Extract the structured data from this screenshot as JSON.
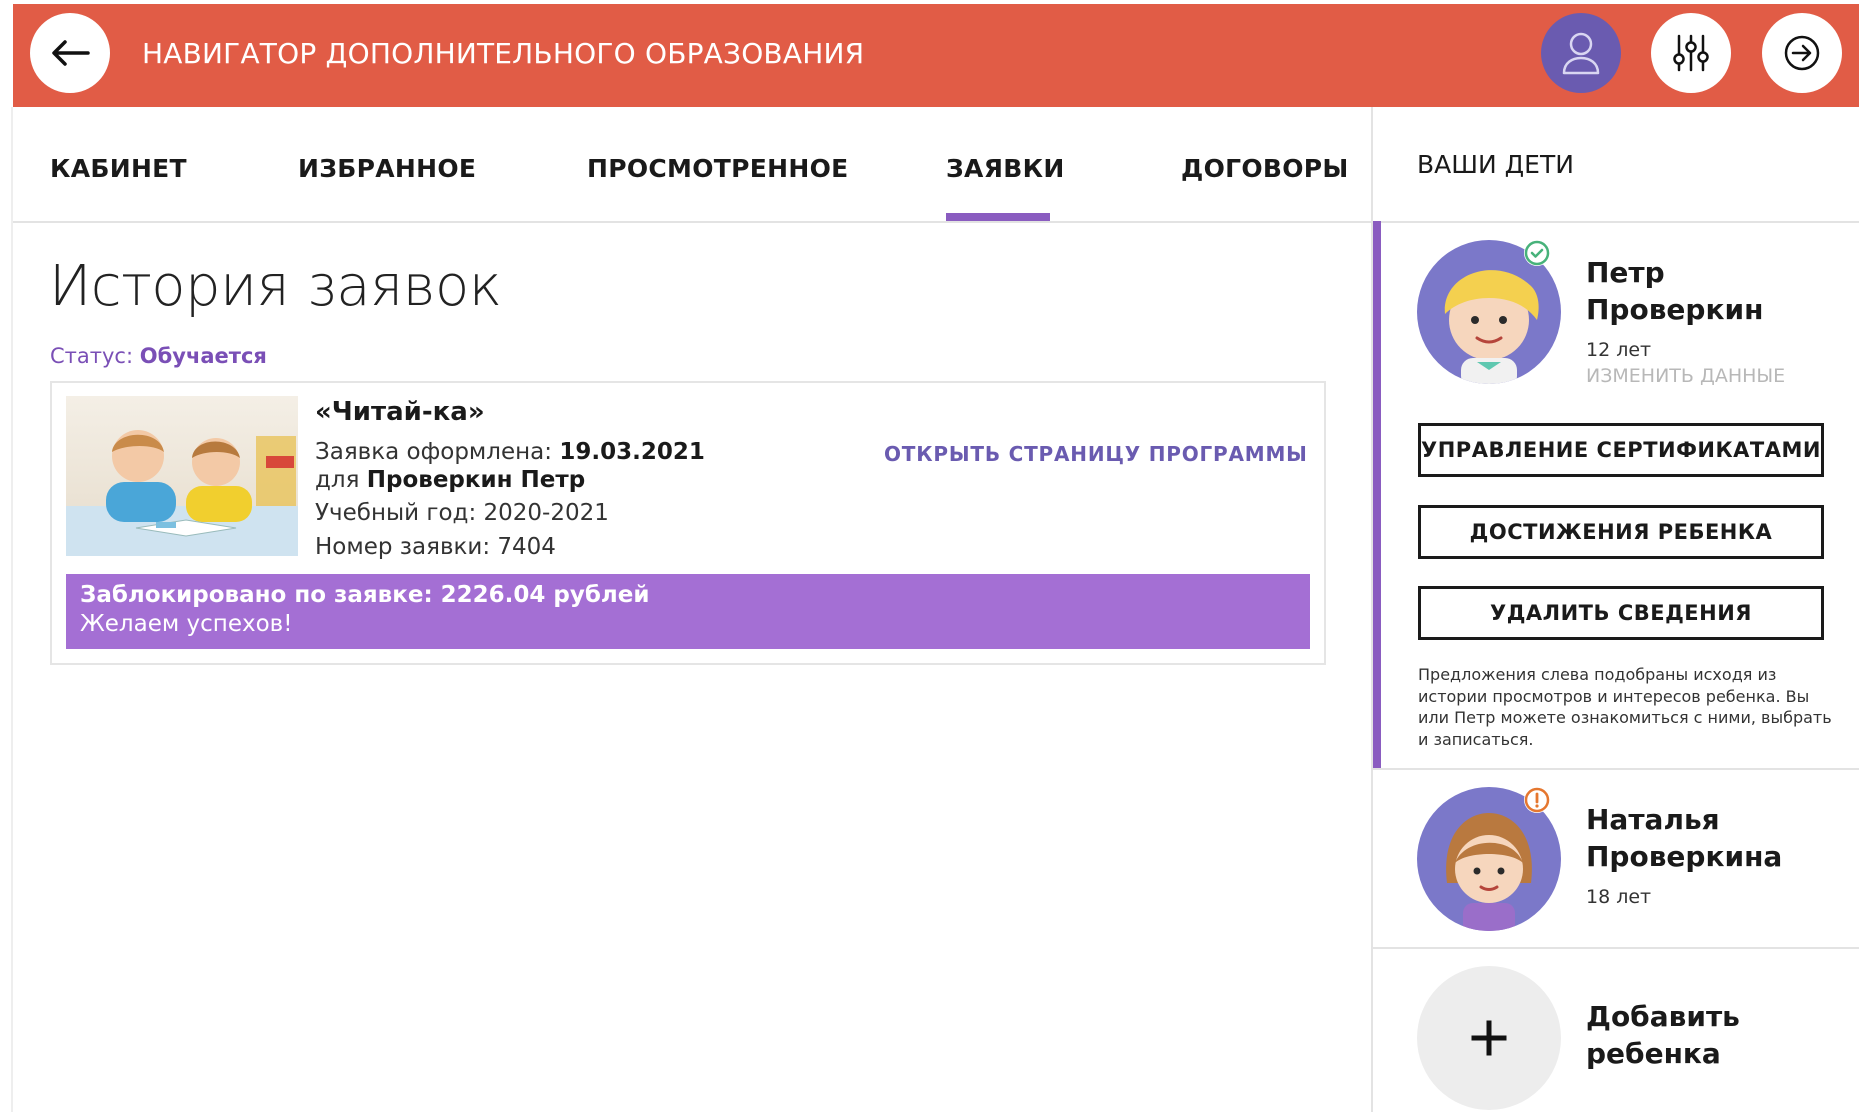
{
  "header": {
    "title": "НАВИГАТОР ДОПОЛНИТЕЛЬНОГО ОБРАЗОВАНИЯ",
    "color": "#e15c46"
  },
  "nav": {
    "tabs": [
      {
        "label": "КАБИНЕТ",
        "active": false
      },
      {
        "label": "ИЗБРАННОЕ",
        "active": false
      },
      {
        "label": "ПРОСМОТРЕННОЕ",
        "active": false
      },
      {
        "label": "ЗАЯВКИ",
        "active": true
      },
      {
        "label": "ДОГОВОРЫ",
        "active": false
      }
    ],
    "accent_color": "#8a5cc0"
  },
  "main": {
    "page_title": "История заявок",
    "status_label": "Статус:",
    "status_value": "Обучается",
    "application": {
      "program_title": "«Читай-ка»",
      "created_label": "Заявка оформлена:",
      "created_date": "19.03.2021",
      "for_label": "для",
      "for_name": "Проверкин Петр",
      "year_label": "Учебный год:",
      "year_value": "2020-2021",
      "number_label": "Номер заявки:",
      "number_value": "7404",
      "open_link": "ОТКРЫТЬ СТРАНИЦУ ПРОГРАММЫ",
      "banner_line1": "Заблокировано по заявке: 2226.04 рублей",
      "banner_line2": "Желаем успехов!",
      "banner_color": "#a46fd4"
    }
  },
  "side": {
    "title": "ВАШИ ДЕТИ",
    "children": [
      {
        "name_line1": "Петр",
        "name_line2": "Проверкин",
        "age": "12 лет",
        "edit_link": "ИЗМЕНИТЬ ДАННЫЕ",
        "status_icon": "check-circle-icon"
      },
      {
        "name_line1": "Наталья",
        "name_line2": "Проверкина",
        "age": "18 лет",
        "status_icon": "warning-circle-icon"
      }
    ],
    "buttons": {
      "certificates": "УПРАВЛЕНИЕ СЕРТИФИКАТАМИ",
      "achievements": "ДОСТИЖЕНИЯ РЕБЕНКА",
      "delete": "УДАЛИТЬ СВЕДЕНИЯ"
    },
    "hint": "Предложения слева подобраны исходя из истории просмотров и интересов ребенка. Вы или Петр можете ознакомиться с ними, выбрать и записаться.",
    "add_child_line1": "Добавить",
    "add_child_line2": "ребенка",
    "add_icon": "plus-icon"
  }
}
